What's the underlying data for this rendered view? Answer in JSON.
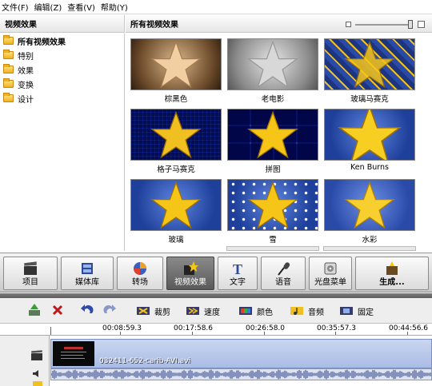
{
  "menu": [
    "文件(F)",
    "编辑(Z)",
    "查看(V)",
    "帮助(Y)"
  ],
  "left_panel": {
    "title": "视频效果",
    "items": [
      {
        "label": "所有视频效果",
        "selected": true
      },
      {
        "label": "特别",
        "selected": false
      },
      {
        "label": "效果",
        "selected": false
      },
      {
        "label": "变换",
        "selected": false
      },
      {
        "label": "设计",
        "selected": false
      }
    ]
  },
  "right_panel": {
    "title": "所有视频效果",
    "tiles": [
      {
        "label": "棕黑色",
        "style": "sepia"
      },
      {
        "label": "老电影",
        "style": "oldfilm"
      },
      {
        "label": "玻璃马赛克",
        "style": "glassmosaic"
      },
      {
        "label": "格子马赛克",
        "style": "gridmosaic"
      },
      {
        "label": "拼图",
        "style": "puzzle"
      },
      {
        "label": "Ken Burns",
        "style": "kenburns"
      },
      {
        "label": "玻璃",
        "style": "glass"
      },
      {
        "label": "雪",
        "style": "snow"
      },
      {
        "label": "水彩",
        "style": "watercolor"
      }
    ]
  },
  "toolbar": {
    "buttons": [
      {
        "label": "项目",
        "icon": "clapperboard-icon"
      },
      {
        "label": "媒体库",
        "icon": "film-library-icon"
      },
      {
        "label": "转场",
        "icon": "transition-swirl-icon"
      },
      {
        "label": "视频效果",
        "icon": "star-clapper-icon",
        "active": true
      },
      {
        "label": "文字",
        "icon": "text-t-icon"
      },
      {
        "label": "语音",
        "icon": "microphone-icon"
      },
      {
        "label": "光盘菜单",
        "icon": "disc-menu-icon"
      },
      {
        "label": "生成...",
        "icon": "produce-icon"
      }
    ]
  },
  "edit_toolbar": {
    "tools": [
      {
        "label": "裁剪",
        "icon": "crop-icon"
      },
      {
        "label": "速度",
        "icon": "speed-icon"
      },
      {
        "label": "颜色",
        "icon": "color-icon"
      },
      {
        "label": "音频",
        "icon": "audio-note-icon"
      },
      {
        "label": "固定",
        "icon": "freeze-icon"
      }
    ]
  },
  "timeline": {
    "markers": [
      "00:08:59.3",
      "00:17:58.6",
      "00:26:58.0",
      "00:35:57.3",
      "00:44:56.6"
    ],
    "clip_name": "032411-652-carib-AVI.avi"
  },
  "colors": {
    "accent_blue": "#3a64c8",
    "star_gold": "#f5c518",
    "active_button": "#6a6a6a"
  }
}
